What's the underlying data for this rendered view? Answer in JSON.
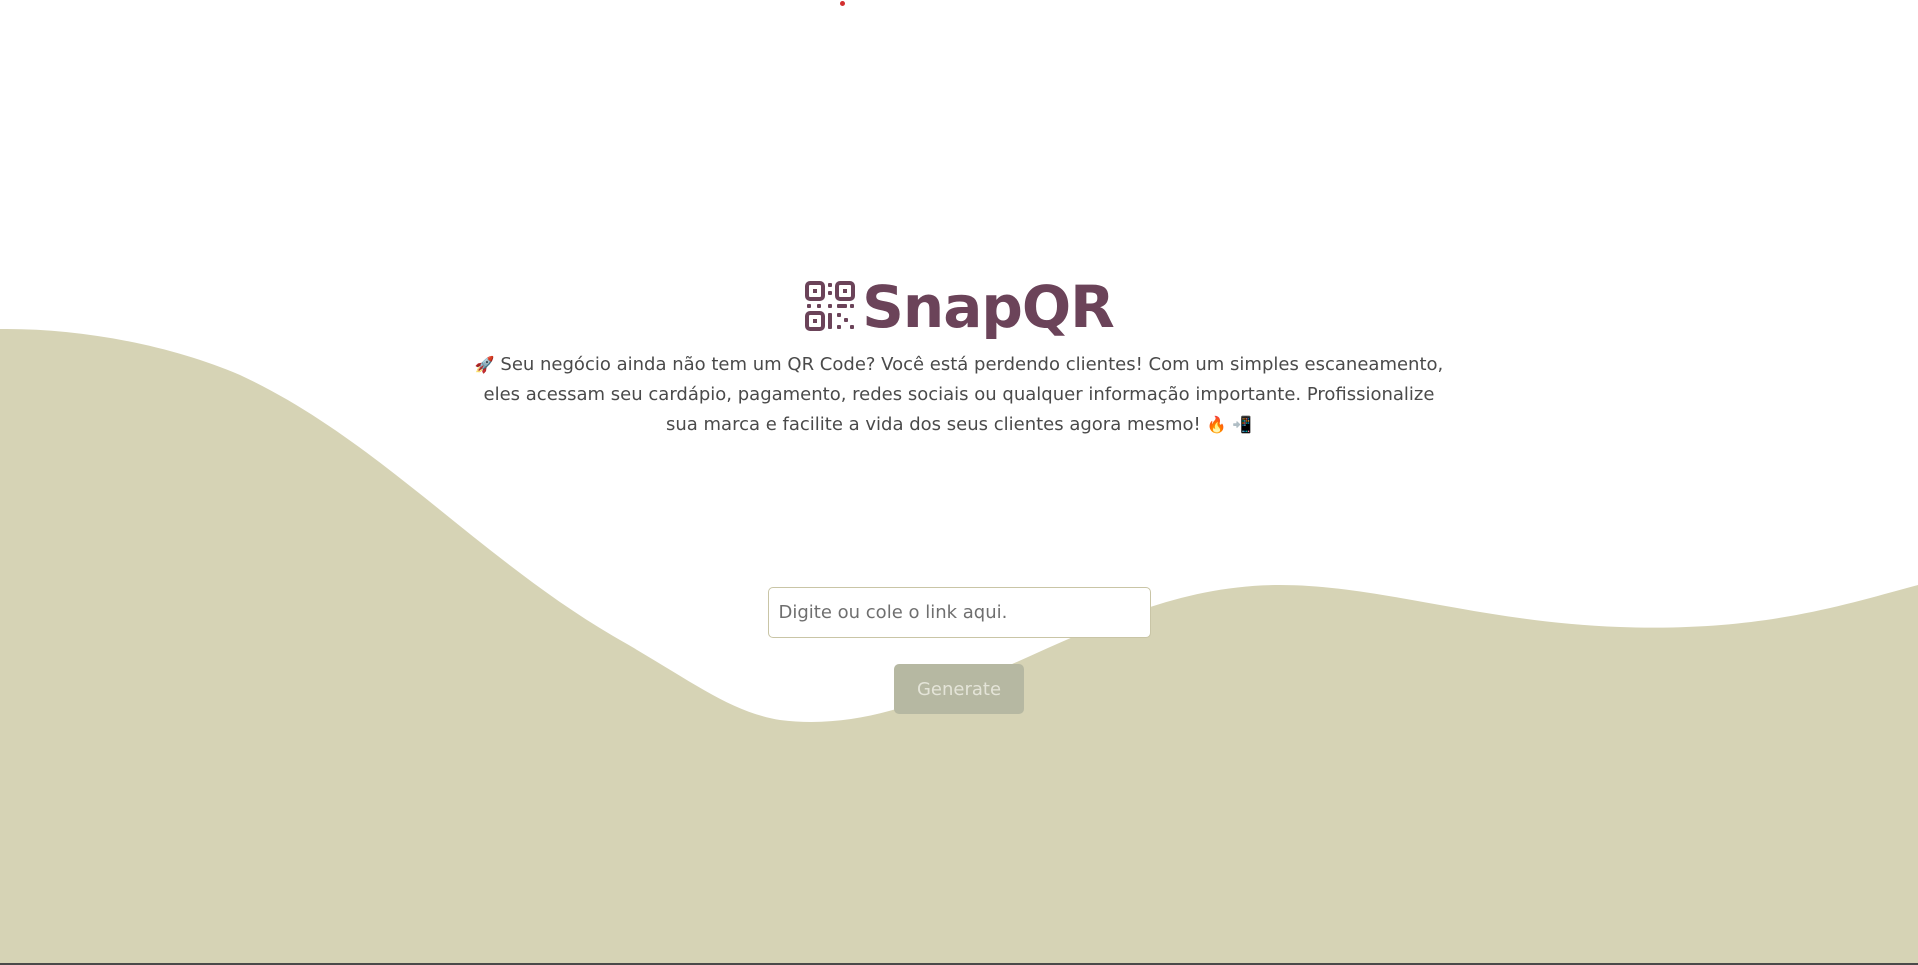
{
  "brand": {
    "title": "SnapQR",
    "icon": "qr-code-icon",
    "color": "#6b4359"
  },
  "hero": {
    "rocket_emoji": "🚀",
    "description": "Seu negócio ainda não tem um QR Code? Você está perdendo clientes! Com um simples escaneamento, eles acessam seu cardápio, pagamento, redes sociais ou qualquer informação importante. Profissionalize sua marca e facilite a vida dos seus clientes agora mesmo!",
    "fire_emoji": "🔥",
    "phone_emoji": "📲"
  },
  "form": {
    "placeholder": "Digite ou cole o link aqui.",
    "value": "",
    "generate_label": "Generate"
  },
  "colors": {
    "background": "#ffffff",
    "wave": "#d6d3b5",
    "button_disabled": "#b6b8a2",
    "input_border": "#c9c5a6"
  }
}
